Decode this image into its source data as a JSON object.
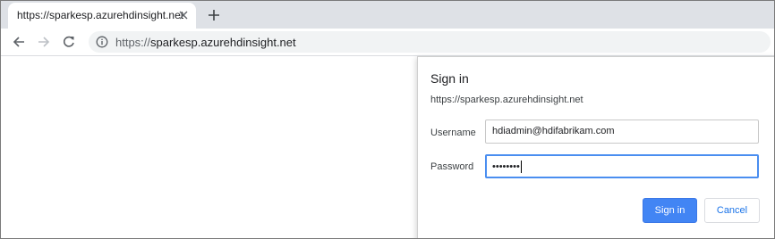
{
  "browser": {
    "tab": {
      "title": "https://sparkesp.azurehdinsight.net",
      "close_icon": "close-icon"
    },
    "new_tab_icon": "plus-icon",
    "toolbar": {
      "back_icon": "arrow-left-icon",
      "forward_icon": "arrow-right-icon",
      "reload_icon": "reload-icon",
      "site_info_icon": "info-icon",
      "url_scheme": "https://",
      "url_host": "sparkesp.azurehdinsight.net"
    }
  },
  "dialog": {
    "title": "Sign in",
    "origin": "https://sparkesp.azurehdinsight.net",
    "username_label": "Username",
    "username_value": "hdiadmin@hdifabrikam.com",
    "password_label": "Password",
    "password_mask": "••••••••",
    "sign_in_label": "Sign in",
    "cancel_label": "Cancel"
  },
  "colors": {
    "accent": "#4285f4",
    "focus_border": "#4a8ef0",
    "tabstrip": "#dee1e6",
    "omnibox": "#f1f3f4"
  }
}
